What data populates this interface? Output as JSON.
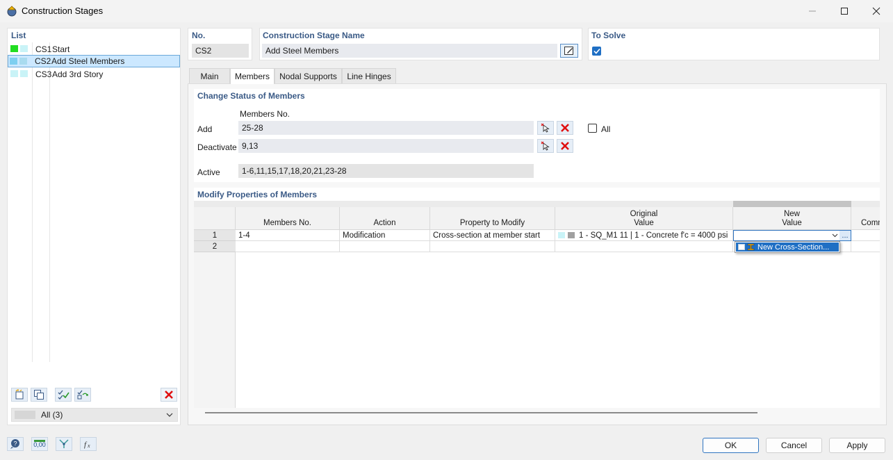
{
  "window": {
    "title": "Construction Stages"
  },
  "list": {
    "label": "List",
    "items": [
      {
        "id": "CS1",
        "name": "Start",
        "color1": "#22dd22",
        "color2": "#c9f3f7"
      },
      {
        "id": "CS2",
        "name": "Add Steel Members",
        "color1": "#7ecff0",
        "color2": "#a9dbef",
        "selected": true
      },
      {
        "id": "CS3",
        "name": "Add 3rd Story",
        "color1": "#c9f3f7",
        "color2": "#c9f3f7"
      }
    ],
    "filter_value": "All (3)"
  },
  "header": {
    "no_label": "No.",
    "no_value": "CS2",
    "name_label": "Construction Stage Name",
    "name_value": "Add Steel Members",
    "to_solve_label": "To Solve",
    "to_solve_checked": true
  },
  "tabs": [
    {
      "label": "Main",
      "active": false
    },
    {
      "label": "Members",
      "active": true
    },
    {
      "label": "Nodal Supports",
      "active": false
    },
    {
      "label": "Line Hinges",
      "active": false
    }
  ],
  "change_status": {
    "title": "Change Status of Members",
    "column_label": "Members No.",
    "add_label": "Add",
    "add_value": "25-28",
    "deactivate_label": "Deactivate",
    "deactivate_value": "9,13",
    "all_label": "All",
    "active_label": "Active",
    "active_value": "1-6,11,15,17,18,20,21,23-28"
  },
  "modify": {
    "title": "Modify Properties of Members",
    "headers": {
      "members_no": "Members No.",
      "action": "Action",
      "property": "Property to Modify",
      "original_1": "Original",
      "original_2": "Value",
      "new_1": "New",
      "new_2": "Value",
      "comment": "Comm"
    },
    "rows": [
      {
        "num": "1",
        "members": "1-4",
        "action": "Modification",
        "property": "Cross-section at member start",
        "original": "1 - SQ_M1 11 | 1 - Concrete f'c = 4000 psi",
        "new": ""
      },
      {
        "num": "2",
        "members": "",
        "action": "",
        "property": "",
        "original": "",
        "new": ""
      }
    ],
    "dropdown_option": "New Cross-Section...",
    "ellipsis": "..."
  },
  "buttons": {
    "ok": "OK",
    "cancel": "Cancel",
    "apply": "Apply"
  },
  "icons": {
    "zero_label": "0,00"
  }
}
